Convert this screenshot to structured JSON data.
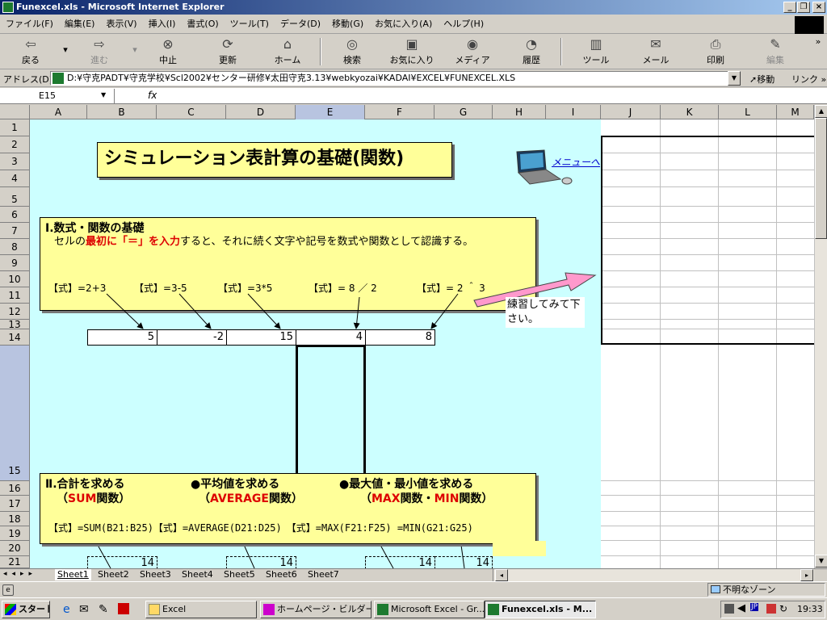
{
  "window": {
    "title": "Funexcel.xls - Microsoft Internet Explorer"
  },
  "menu": [
    "ファイル(F)",
    "編集(E)",
    "表示(V)",
    "挿入(I)",
    "書式(O)",
    "ツール(T)",
    "データ(D)",
    "移動(G)",
    "お気に入り(A)",
    "ヘルプ(H)"
  ],
  "toolbar": {
    "back": "戻る",
    "forward": "進む",
    "stop": "中止",
    "refresh": "更新",
    "home": "ホーム",
    "search": "検索",
    "favorites": "お気に入り",
    "media": "メディア",
    "history": "履歴",
    "tools": "ツール",
    "mail": "メール",
    "print": "印刷",
    "edit": "編集"
  },
  "address": {
    "label": "アドレス(D)",
    "url": "D:¥守克PADT¥守克学校¥Scl2002¥センター研修¥太田守克3.13¥webkyozai¥KADAI¥EXCEL¥FUNEXCEL.XLS",
    "go": "移動",
    "links": "リンク"
  },
  "formula": {
    "cell": "E15",
    "fx": "fx",
    "value": ""
  },
  "columns": [
    "A",
    "B",
    "C",
    "D",
    "E",
    "F",
    "G",
    "H",
    "I",
    "J",
    "K",
    "L",
    "M"
  ],
  "rows": [
    "1",
    "2",
    "3",
    "4",
    "5",
    "6",
    "7",
    "8",
    "9",
    "10",
    "11",
    "12",
    "13",
    "14",
    "15",
    "16",
    "17",
    "18",
    "19",
    "20",
    "21"
  ],
  "sheet": {
    "title": "シミュレーション表計算の基礎(関数)",
    "menu_link": "メニューへ",
    "section1": {
      "heading": "Ⅰ.数式・関数の基礎",
      "text_a": "　セルの",
      "text_b": "最初に「＝」を入力",
      "text_c": "すると、それに続く文字や記号を数式や関数として認識する。",
      "formulas": [
        "【式】=2+3",
        "【式】=3-5",
        "【式】=3*5",
        "【式】= 8 ／ 2",
        "【式】= 2 ＾ 3"
      ],
      "results": [
        "5",
        "-2",
        "15",
        "4",
        "8"
      ]
    },
    "practice": "練習してみて下さい。",
    "section2": {
      "heading1": "Ⅱ.合計を求める",
      "sub1_a": "（",
      "sub1_red": "SUM",
      "sub1_b": "関数）",
      "heading2": "●平均値を求める",
      "sub2_a": "（",
      "sub2_red": "AVERAGE",
      "sub2_b": "関数）",
      "heading3": "●最大値・最小値を求める",
      "sub3_a": "（",
      "sub3_red1": "MAX",
      "sub3_mid": "関数・",
      "sub3_red2": "MIN",
      "sub3_b": "関数）",
      "formula_line": "【式】=SUM(B21:B25)【式】=AVERAGE(D21:D25)　【式】=MAX(F21:F25) =MIN(G21:G25)",
      "row21": [
        "14",
        "14",
        "14",
        "14"
      ]
    }
  },
  "tabs": [
    "Sheet1",
    "Sheet2",
    "Sheet3",
    "Sheet4",
    "Sheet5",
    "Sheet6",
    "Sheet7"
  ],
  "status": {
    "zone": "不明なゾーン"
  },
  "taskbar": {
    "start": "スタート",
    "tasks": [
      "Excel",
      "ホームページ・ビルダー...",
      "Microsoft Excel - Gr...",
      "Funexcel.xls - M..."
    ],
    "ime": "JP",
    "clock": "19:33"
  }
}
